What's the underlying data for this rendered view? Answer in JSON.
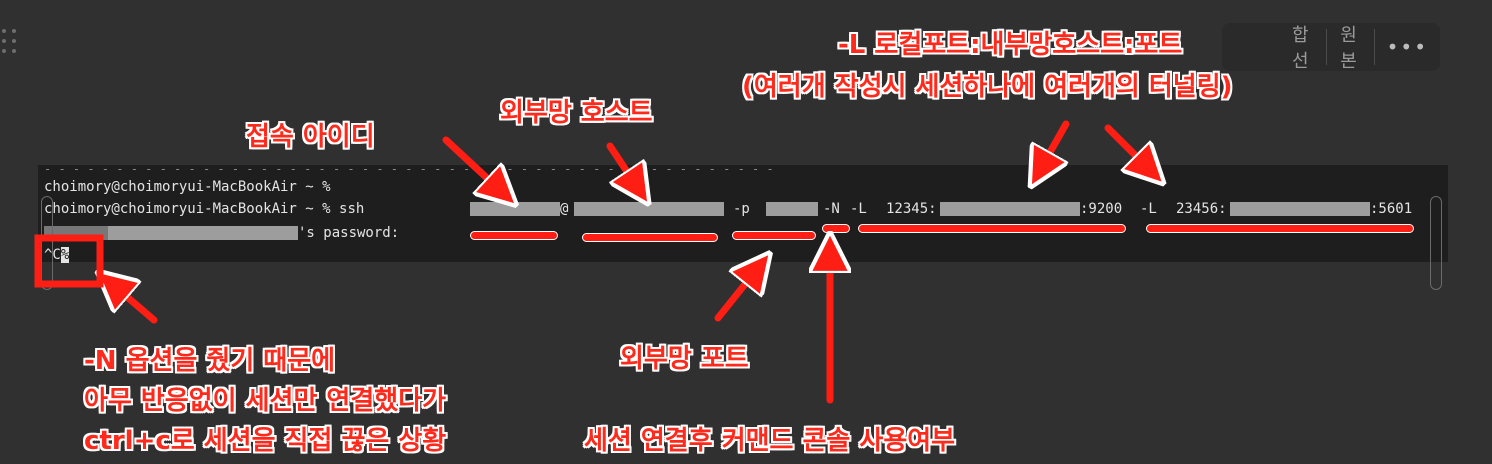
{
  "toolbar": {
    "merge_label": "합선",
    "raw_label": "원본",
    "more_label": "•••"
  },
  "terminal": {
    "line1": "choimory@choimoryui-MacBookAir ~ %",
    "line2_prompt": "choimory@choimoryui-MacBookAir ~ %",
    "line2_cmd": "ssh",
    "at_sign": "@",
    "flag_p": "-p",
    "flag_n": "-N",
    "flag_l1": "-L",
    "tunnel1_local": "12345:",
    "tunnel1_port": ":9200",
    "flag_l2": "-L",
    "tunnel2_local": "23456:",
    "tunnel2_port": ":5601",
    "password_suffix": "'s password:",
    "interrupt": "^C"
  },
  "annotations": {
    "login_id": "접속 아이디",
    "external_host": "외부망 호스트",
    "tunnel_title": "-L 로컬포트:내부망호스트:포트",
    "tunnel_note": "(여러개 작성시 세션하나에 여러개의 터널링)",
    "external_port": "외부망 포트",
    "console_usage": "세션 연결후 커맨드 콘솔 사용여부",
    "n_option_line1": "-N 옵션을 줬기 때문에",
    "n_option_line2": "아무 반응없이 세션만 연결했다가",
    "n_option_line3": "ctrl+c로 세션을 직접 끊은 상황"
  }
}
